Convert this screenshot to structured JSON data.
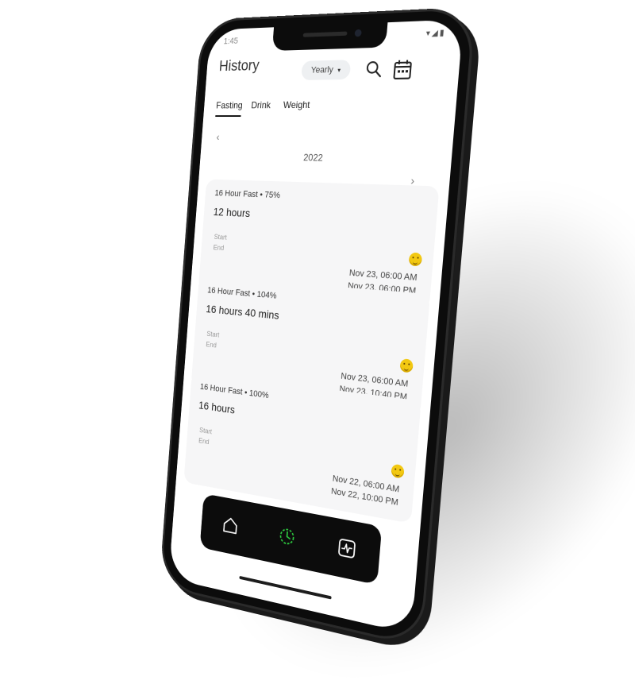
{
  "status": {
    "time": "1:45",
    "icons": "▾◢▮"
  },
  "header": {
    "title": "History",
    "period": "Yearly"
  },
  "tabs": [
    {
      "label": "Fasting"
    },
    {
      "label": "Drink"
    },
    {
      "label": "Weight"
    }
  ],
  "year": "2022",
  "icons": {
    "prev": "‹",
    "next": "›",
    "caret": "▾",
    "search": "search-icon",
    "calendar": "calendar-icon"
  },
  "cards": [
    {
      "subtitle": "16 Hour Fast • 75%",
      "duration": "12 hours",
      "start_label": "Start",
      "end_label": "End",
      "start_date": "Nov 23, 06:00 AM",
      "end_date": "Nov 23, 06:00 PM"
    },
    {
      "subtitle": "16 Hour Fast • 104%",
      "duration": "16 hours 40 mins",
      "start_label": "Start",
      "end_label": "End",
      "start_date": "Nov 23, 06:00 AM",
      "end_date": "Nov 23, 10:40 PM"
    },
    {
      "subtitle": "16 Hour Fast • 100%",
      "duration": "16 hours",
      "start_label": "Start",
      "end_label": "End",
      "start_date": "Nov 22, 06:00 AM",
      "end_date": "Nov 22, 10:00 PM"
    }
  ],
  "colors": {
    "accent_active": "#2ecc40",
    "emoji": "#f2c811"
  }
}
